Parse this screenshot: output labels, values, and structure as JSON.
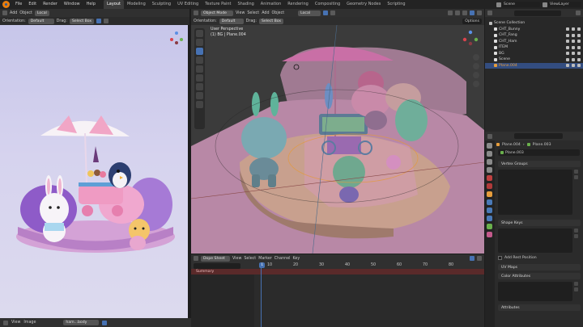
{
  "topbar": {
    "menus": [
      "File",
      "Edit",
      "Render",
      "Window",
      "Help"
    ],
    "workspaces": [
      "Layout",
      "Modeling",
      "Sculpting",
      "UV Editing",
      "Texture Paint",
      "Shading",
      "Animation",
      "Rendering",
      "Compositing",
      "Geometry Nodes",
      "Scripting"
    ],
    "active_workspace": "Layout",
    "scene": "Scene",
    "view_layer": "ViewLayer"
  },
  "left_view": {
    "header": {
      "add": "Add",
      "object": "Object",
      "transform": "Local",
      "orientation_label": "Orientation:",
      "orientation": "Default",
      "drag_label": "Drag:",
      "drag": "Select Box"
    },
    "footer": {
      "view": "View",
      "image": "Image",
      "image_name": "ham...body"
    }
  },
  "viewport": {
    "mode": "Object Mode",
    "menus": [
      "View",
      "Select",
      "Add",
      "Object"
    ],
    "transform": "Local",
    "orientation_label": "Orientation:",
    "orientation": "Default",
    "drag_label": "Drag:",
    "drag": "Select Box",
    "options": "Options",
    "overlay_title": "User Perspective",
    "overlay_sub": "(1) BG | Plane.004"
  },
  "dopesheet": {
    "mode": "Dope Sheet",
    "menus": [
      "View",
      "Select",
      "Marker",
      "Channel",
      "Key"
    ],
    "ruler": [
      "0",
      "10",
      "20",
      "30",
      "40",
      "50",
      "60",
      "70",
      "80"
    ],
    "current_frame": "1",
    "summary": "Summary"
  },
  "outliner": {
    "search_placeholder": "",
    "root": "Scene Collection",
    "items": [
      {
        "name": "CHT_Bunny",
        "color": "#e0e0e0"
      },
      {
        "name": "CHT_Fang",
        "color": "#e0e0e0"
      },
      {
        "name": "CHT_Ham",
        "color": "#e0e0e0"
      },
      {
        "name": "ITEM",
        "color": "#e0e0e0"
      },
      {
        "name": "BG",
        "color": "#e0e0e0"
      },
      {
        "name": "Scene",
        "color": "#e0e0e0"
      },
      {
        "name": "Plane.004",
        "color": "#e79d3c"
      }
    ]
  },
  "properties": {
    "object": "Plane.004",
    "data": "Plane.003",
    "mesh_name": "Plane.003",
    "panels": [
      "Vertex Groups",
      "Shape Keys",
      "Add Rest Position",
      "UV Maps",
      "Color Attributes",
      "Attributes"
    ]
  },
  "colors": {
    "accent": "#4772b3",
    "orange": "#e87d0d",
    "playhead": "#4772b3",
    "summary": "#5a2a2a"
  }
}
